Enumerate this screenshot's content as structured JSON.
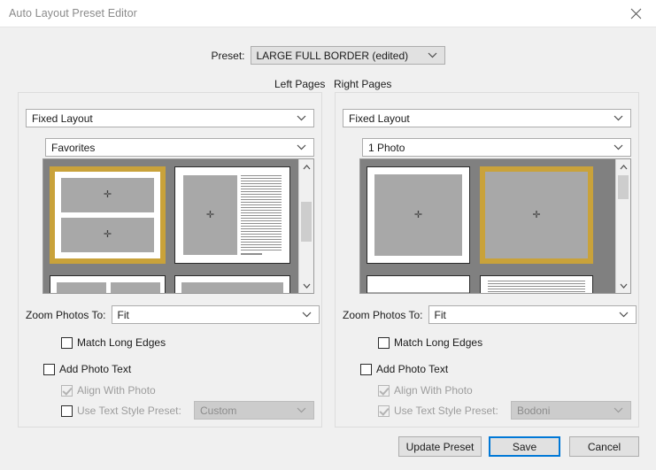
{
  "window": {
    "title": "Auto Layout Preset Editor",
    "close_icon": "close-icon"
  },
  "preset": {
    "label": "Preset:",
    "value": "LARGE FULL BORDER (edited)"
  },
  "headings": {
    "left_pages": "Left Pages",
    "right_pages": "Right Pages"
  },
  "left_panel": {
    "layout_mode": "Fixed Layout",
    "template_group": "Favorites",
    "zoom_label": "Zoom Photos To:",
    "zoom_value": "Fit",
    "match_long_edges": "Match Long Edges",
    "add_photo_text": "Add Photo Text",
    "align_with_photo": "Align With Photo",
    "use_text_style_preset": "Use Text Style Preset:",
    "text_style_value": "Custom",
    "selected_thumb_index": 0
  },
  "right_panel": {
    "layout_mode": "Fixed Layout",
    "template_group": "1 Photo",
    "zoom_label": "Zoom Photos To:",
    "zoom_value": "Fit",
    "match_long_edges": "Match Long Edges",
    "add_photo_text": "Add Photo Text",
    "align_with_photo": "Align With Photo",
    "use_text_style_preset": "Use Text Style Preset:",
    "text_style_value": "Bodoni",
    "selected_thumb_index": 1
  },
  "buttons": {
    "update_preset": "Update Preset",
    "save": "Save",
    "cancel": "Cancel"
  },
  "colors": {
    "selection": "#c9a23a",
    "focus": "#0078d7",
    "thumb_bg": "#808080",
    "photo_fill": "#a8a8a8"
  }
}
